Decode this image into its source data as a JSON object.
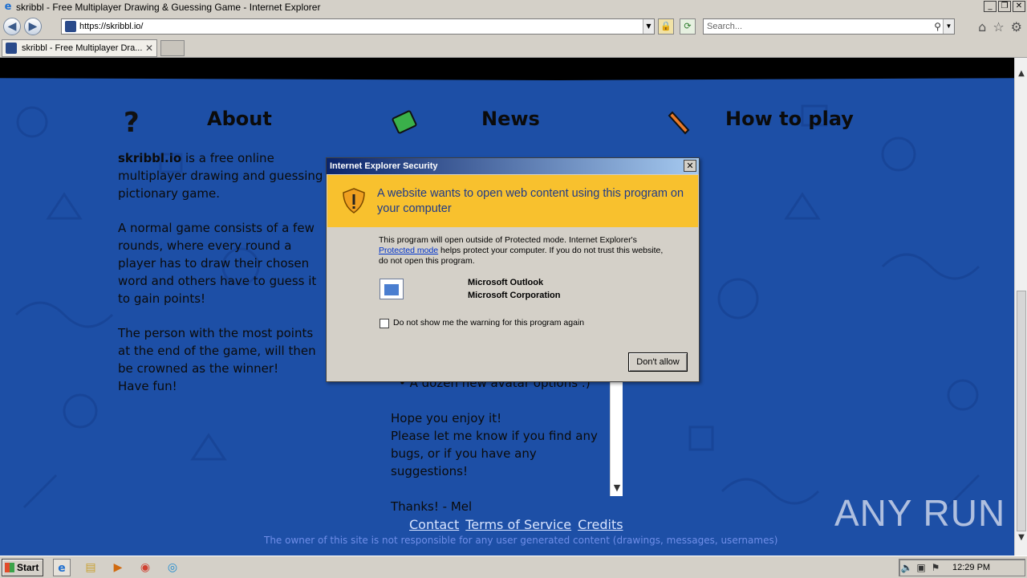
{
  "window": {
    "title": "skribbl - Free Multiplayer Drawing & Guessing Game - Internet Explorer",
    "controls": [
      "_",
      "❐",
      "✕"
    ]
  },
  "address_bar": {
    "url": "https://skribbl.io/",
    "search_placeholder": "Search..."
  },
  "tabs": [
    {
      "label": "skribbl - Free Multiplayer Dra...",
      "close": "✕"
    }
  ],
  "page": {
    "sections": {
      "about": {
        "title": "About"
      },
      "news": {
        "title": "News"
      },
      "howto": {
        "title": "How to play"
      }
    },
    "about_paragraphs": [
      "skribbl.io is a free online multiplayer drawing and guessing pictionary game.",
      "A normal game consists of a few rounds, where every round a player has to draw their chosen word and others have to guess it to gain points!",
      "The person with the most points at the end of the game, will then be crowned as the winner!",
      "Have fun!"
    ],
    "about_bold": "skribbl.io",
    "news": {
      "bullet": "A dozen new avatar options :)",
      "enjoy": "Hope you enjoy it!",
      "feedback": "Please let me know if you find any bugs, or if you have any suggestions!",
      "thanks": "Thanks! - Mel"
    },
    "footer_links": [
      "Contact",
      "Terms of Service",
      "Credits"
    ],
    "footer_note": "The owner of this site is not responsible for any user generated content (drawings, messages, usernames)",
    "watermark": "ANY RUN"
  },
  "dialog": {
    "title": "Internet Explorer Security",
    "heading": "A website wants to open web content using this program on your computer",
    "body_before_link": "This program will open outside of Protected mode. Internet Explorer's ",
    "body_link": "Protected mode",
    "body_after_link": " helps protect your computer. If you do not trust this website, do not open this program.",
    "program_name": "Microsoft Outlook",
    "program_publisher": "Microsoft Corporation",
    "checkbox_label": "Do not show me the warning for this program again",
    "button": "Don't allow"
  },
  "taskbar": {
    "start": "Start",
    "clock": "12:29 PM"
  },
  "colors": {
    "page_bg": "#1d4fa6",
    "warning_banner": "#f8c12e"
  }
}
